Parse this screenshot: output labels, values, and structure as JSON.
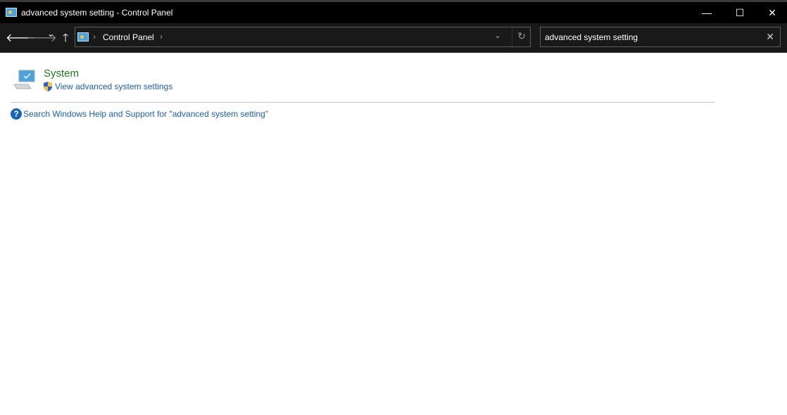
{
  "window": {
    "title": "advanced system setting - Control Panel",
    "minimize_glyph": "—",
    "maximize_glyph": "☐",
    "close_glyph": "✕"
  },
  "nav": {
    "back_glyph": "🡐",
    "forward_glyph": "🡒",
    "recent_glyph": "⌄",
    "up_glyph": "🡑"
  },
  "address": {
    "sep": "›",
    "breadcrumb": [
      "Control Panel"
    ],
    "dropdown_glyph": "⌄",
    "refresh_glyph": "↻"
  },
  "search": {
    "value": "advanced system setting",
    "clear_glyph": "✕"
  },
  "results": {
    "category_title": "System",
    "task_link": "View advanced system settings",
    "help_glyph": "?",
    "help_link": "Search Windows Help and Support for \"advanced system setting\""
  }
}
